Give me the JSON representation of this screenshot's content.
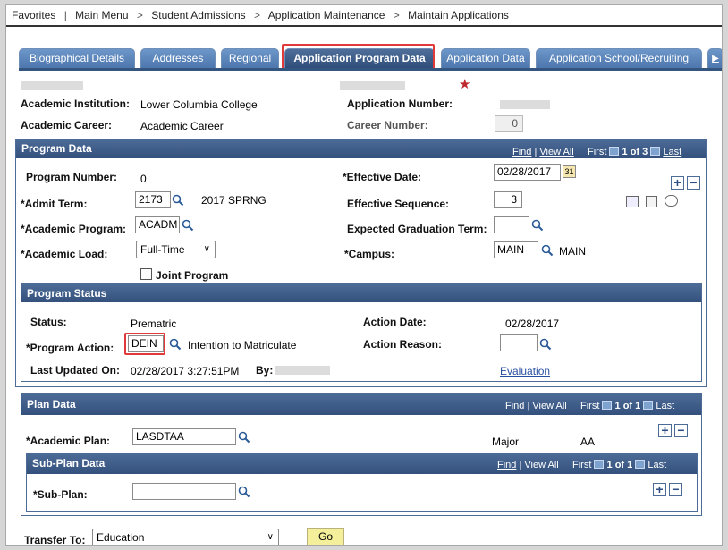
{
  "breadcrumb": [
    "Favorites",
    "Main Menu",
    "Student Admissions",
    "Application Maintenance",
    "Maintain Applications"
  ],
  "tabs": [
    "Biographical Details",
    "Addresses",
    "Regional",
    "Application Program Data",
    "Application Data",
    "Application School/Recruiting"
  ],
  "header": {
    "institution_label": "Academic Institution:",
    "institution_value": "Lower Columbia College",
    "app_number_label": "Application Number:",
    "career_label": "Academic Career:",
    "career_value": "Academic Career",
    "career_number_label": "Career Number:",
    "career_number": "0"
  },
  "program_data": {
    "title": "Program Data",
    "nav_find": "Find",
    "nav_viewall": "View All",
    "nav_first": "First",
    "nav_count": "1 of 3",
    "nav_last": "Last",
    "program_number_label": "Program Number:",
    "program_number": "0",
    "effective_date_label": "*Effective Date:",
    "effective_date": "02/28/2017",
    "admit_term_label": "*Admit Term:",
    "admit_term": "2173",
    "admit_term_desc": "2017 SPRNG",
    "effective_sequence_label": "Effective Sequence:",
    "effective_sequence": "3",
    "academic_program_label": "*Academic Program:",
    "academic_program": "ACADM",
    "expected_grad_label": "Expected Graduation Term:",
    "expected_grad": "",
    "academic_load_label": "*Academic Load:",
    "academic_load": "Full-Time",
    "campus_label": "*Campus:",
    "campus": "MAIN",
    "campus_desc": "MAIN",
    "joint_program_label": "Joint Program"
  },
  "program_status": {
    "title": "Program Status",
    "status_label": "Status:",
    "status": "Prematric",
    "action_date_label": "Action Date:",
    "action_date": "02/28/2017",
    "program_action_label": "*Program Action:",
    "program_action": "DEIN",
    "program_action_desc": "Intention to Matriculate",
    "action_reason_label": "Action Reason:",
    "action_reason": "",
    "last_updated_label": "Last Updated On:",
    "last_updated": "02/28/2017  3:27:51PM",
    "by_label": "By:",
    "evaluation_link": "Evaluation"
  },
  "plan_data": {
    "title": "Plan Data",
    "nav_find": "Find",
    "nav_viewall": "View All",
    "nav_first": "First",
    "nav_count": "1 of 1",
    "nav_last": "Last",
    "academic_plan_label": "*Academic Plan:",
    "academic_plan": "LASDTAA",
    "plan_type": "Major",
    "plan_degree": "AA"
  },
  "subplan_data": {
    "title": "Sub-Plan Data",
    "nav_find": "Find",
    "nav_viewall": "View All",
    "nav_first": "First",
    "nav_count": "1 of 1",
    "nav_last": "Last",
    "sub_plan_label": "*Sub-Plan:",
    "sub_plan": ""
  },
  "footer": {
    "transfer_label": "Transfer To:",
    "transfer_value": "Education",
    "go_label": "Go"
  },
  "colors": {
    "header_blue": "#33517c",
    "tab_blue": "#5b85bb",
    "highlight_red": "#e03a3a",
    "go_button": "#f4ef9a"
  }
}
